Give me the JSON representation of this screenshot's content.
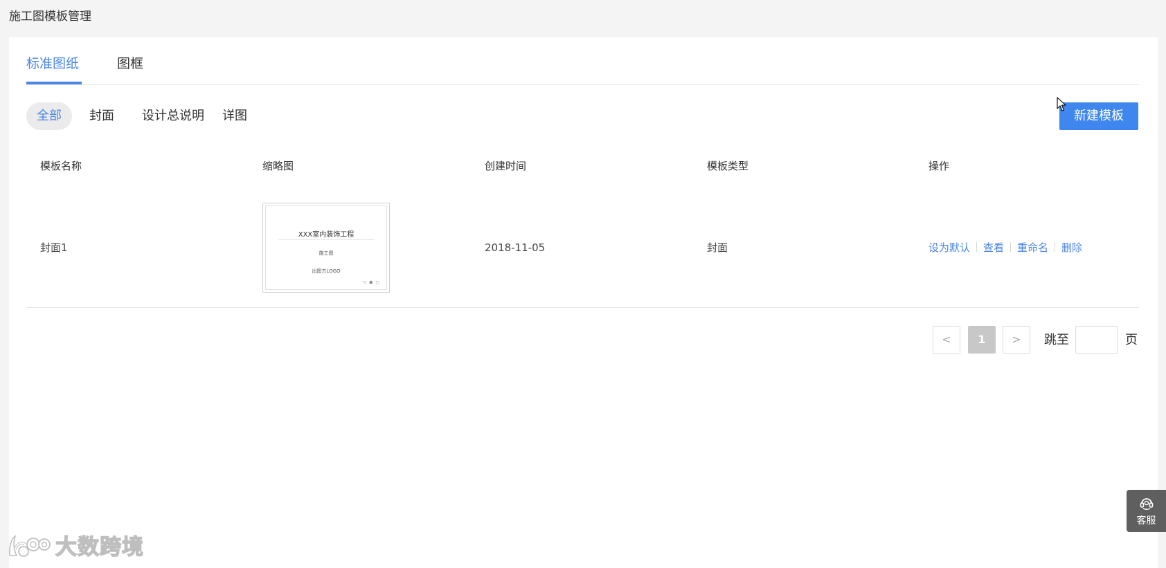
{
  "page": {
    "title": "施工图模板管理"
  },
  "tabs": [
    {
      "label": "标准图纸",
      "active": true
    },
    {
      "label": "图框",
      "active": false
    }
  ],
  "filters": [
    {
      "label": "全部",
      "active": true
    },
    {
      "label": "封面",
      "active": false
    },
    {
      "label": "设计总说明",
      "active": false
    },
    {
      "label": "详图",
      "active": false
    }
  ],
  "toolbar": {
    "new_label": "新建模板"
  },
  "table": {
    "columns": [
      "模板名称",
      "缩略图",
      "创建时间",
      "模板类型",
      "操作"
    ],
    "rows": [
      {
        "name": "封面1",
        "thumbnail": {
          "title": "XXX室内装饰工程",
          "subtitle": "施工图",
          "logo": "出图方LOGO",
          "corner": "▽ ☗ ▢"
        },
        "created": "2018-11-05",
        "type": "封面",
        "actions": [
          "设为默认",
          "查看",
          "重命名",
          "删除"
        ]
      }
    ]
  },
  "pagination": {
    "prev": "<",
    "current": "1",
    "next": ">",
    "jump_label": "跳至",
    "jump_value": "",
    "unit": "页"
  },
  "service": {
    "label": "客服",
    "icon": "headset-icon"
  },
  "watermark": {
    "text": "大数跨境",
    "icon": "kuajing-logo-icon"
  },
  "colors": {
    "accent": "#4a86e8",
    "button": "#3f86ef",
    "background": "#f4f4f4",
    "service": "#5f5f5f"
  }
}
